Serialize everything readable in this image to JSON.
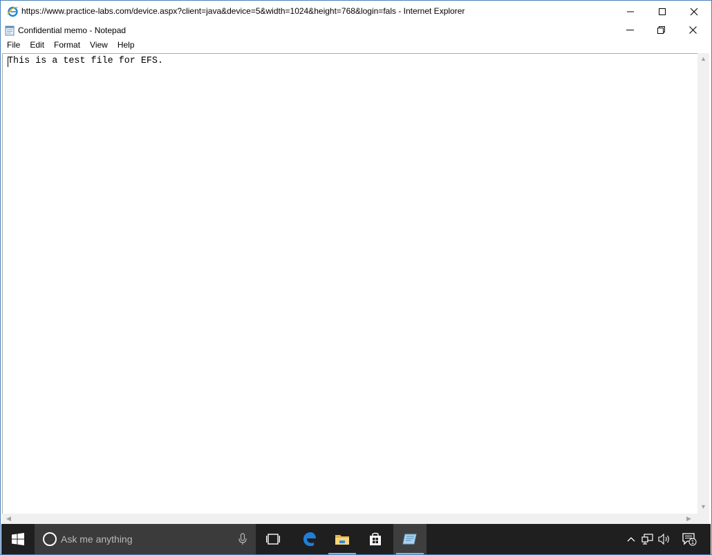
{
  "browser": {
    "title": "https://www.practice-labs.com/device.aspx?client=java&device=5&width=1024&height=768&login=fals - Internet Explorer",
    "icon": "internet-explorer-icon"
  },
  "notepad": {
    "title": "Confidential memo - Notepad",
    "icon": "notepad-icon",
    "menu": [
      "File",
      "Edit",
      "Format",
      "View",
      "Help"
    ],
    "content": "This is a test file for EFS."
  },
  "taskbar": {
    "search_placeholder": "Ask me anything",
    "apps": [
      "task-view-icon",
      "edge-icon",
      "file-explorer-icon",
      "store-icon",
      "notepad-icon"
    ],
    "active_app": "notepad-icon",
    "notification_count": "1"
  },
  "colors": {
    "taskbar_bg": "#1f1f1f",
    "search_bg": "#3b3b3b",
    "accent": "#76b9ed",
    "frame_border": "#4a7fb5"
  }
}
